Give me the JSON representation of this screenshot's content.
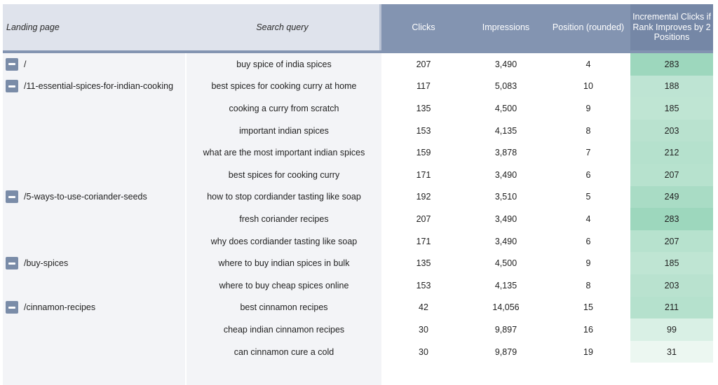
{
  "header": {
    "landing_page": "Landing page",
    "search_query": "Search query",
    "clicks": "Clicks",
    "impressions": "Impressions",
    "position": "Position (rounded)",
    "incremental": "Incremental Clicks if Rank Improves by 2 Positions"
  },
  "colors": {
    "header_light": "#dfe3ec",
    "header_dark": "#8394b1",
    "header_darker": "#7587a6",
    "toggle": "#7a8ca8",
    "heat_high": "#9dd7bd",
    "heat_low": "#f3faf6"
  },
  "rows": [
    {
      "landing_page": "/",
      "toggle": "collapse-icon",
      "query": "buy spice of india spices",
      "clicks": "207",
      "impressions": "3,490",
      "position": "4",
      "incremental": "283",
      "heat": 1.0
    },
    {
      "landing_page": "/11-essential-spices-for-indian-cooking",
      "toggle": "collapse-icon",
      "query": "best spices for cooking curry at home",
      "clicks": "117",
      "impressions": "5,083",
      "position": "10",
      "incremental": "188",
      "heat": 0.62
    },
    {
      "landing_page": "",
      "query": "cooking a curry from scratch",
      "clicks": "135",
      "impressions": "4,500",
      "position": "9",
      "incremental": "185",
      "heat": 0.61
    },
    {
      "landing_page": "",
      "query": "important indian spices",
      "clicks": "153",
      "impressions": "4,135",
      "position": "8",
      "incremental": "203",
      "heat": 0.68
    },
    {
      "landing_page": "",
      "query": "what are the most important indian spices",
      "clicks": "159",
      "impressions": "3,878",
      "position": "7",
      "incremental": "212",
      "heat": 0.72
    },
    {
      "landing_page": "",
      "query": "best spices for cooking curry",
      "clicks": "171",
      "impressions": "3,490",
      "position": "6",
      "incremental": "207",
      "heat": 0.7
    },
    {
      "landing_page": "/5-ways-to-use-coriander-seeds",
      "toggle": "collapse-icon",
      "query": "how to stop cordiander tasting like soap",
      "clicks": "192",
      "impressions": "3,510",
      "position": "5",
      "incremental": "249",
      "heat": 0.86
    },
    {
      "landing_page": "",
      "query": "fresh coriander recipes",
      "clicks": "207",
      "impressions": "3,490",
      "position": "4",
      "incremental": "283",
      "heat": 1.0
    },
    {
      "landing_page": "",
      "query": "why does cordiander tasting like soap",
      "clicks": "171",
      "impressions": "3,490",
      "position": "6",
      "incremental": "207",
      "heat": 0.7
    },
    {
      "landing_page": "/buy-spices",
      "toggle": "collapse-icon",
      "query": "where to buy indian spices in bulk",
      "clicks": "135",
      "impressions": "4,500",
      "position": "9",
      "incremental": "185",
      "heat": 0.61
    },
    {
      "landing_page": "",
      "query": "where to buy cheap spices online",
      "clicks": "153",
      "impressions": "4,135",
      "position": "8",
      "incremental": "203",
      "heat": 0.68
    },
    {
      "landing_page": "/cinnamon-recipes",
      "toggle": "collapse-icon",
      "query": "best cinnamon recipes",
      "clicks": "42",
      "impressions": "14,056",
      "position": "15",
      "incremental": "211",
      "heat": 0.72
    },
    {
      "landing_page": "",
      "query": "cheap indian cinnamon recipes",
      "clicks": "30",
      "impressions": "9,897",
      "position": "16",
      "incremental": "99",
      "heat": 0.3
    },
    {
      "landing_page": "",
      "query": "can cinnamon cure a cold",
      "clicks": "30",
      "impressions": "9,879",
      "position": "19",
      "incremental": "31",
      "heat": 0.08
    },
    {
      "landing_page": "",
      "query": "",
      "clicks": "",
      "impressions": "",
      "position": "",
      "incremental": "",
      "heat": 0.0
    }
  ]
}
